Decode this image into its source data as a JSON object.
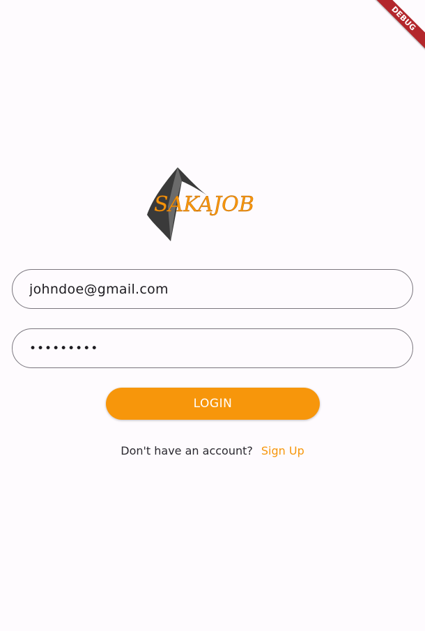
{
  "debug_banner": {
    "label": "DEBUG",
    "color": "#b3272c"
  },
  "logo": {
    "text": "SAKAJOB",
    "text_color": "#f7960b",
    "mark_color": "#3a3a3a"
  },
  "login_form": {
    "email_value": "johndoe@gmail.com",
    "password_value": "•••••••••",
    "login_label": "LOGIN",
    "accent_color": "#f7960b"
  },
  "signup": {
    "prompt": "Don't have an account?",
    "link_label": "Sign Up"
  }
}
